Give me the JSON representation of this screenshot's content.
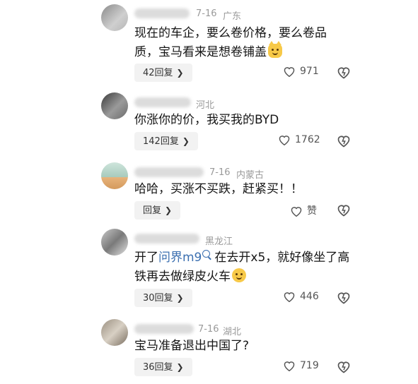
{
  "comments": [
    {
      "date": "7-16",
      "location": "广东",
      "text_line1": "现在的车企，要么卷价格，要么卷品",
      "text_line2": "质，宝马看来是想卷铺盖",
      "emoji": "cat-smile-emoji",
      "reply_label": "42回复",
      "likes": "971"
    },
    {
      "date": "",
      "location": "河北",
      "text_line1": "你涨你的价，我买我的BYD",
      "reply_label": "142回复",
      "likes": "1762"
    },
    {
      "date": "7-16",
      "location": "内蒙古",
      "text_line1": "哈哈，买涨不买跌，赶紧买！！",
      "reply_label": "回复",
      "likes": "赞"
    },
    {
      "date": "",
      "location": "黑龙江",
      "text_prefix": "开了",
      "text_link": "问界m9",
      "text_line1_rest": "在去开x5，就好像坐了高",
      "text_line2": "铁再去做绿皮火车",
      "emoji": "smile-emoji",
      "reply_label": "30回复",
      "likes": "446"
    },
    {
      "date": "7-16",
      "location": "湖北",
      "text_line1": "宝马准备退出中国了?",
      "reply_label": "36回复",
      "likes": "719"
    }
  ],
  "colors": {
    "link": "#3b6fb0",
    "meta": "#9a9a9a",
    "reply_bg": "#f2f2f2"
  }
}
